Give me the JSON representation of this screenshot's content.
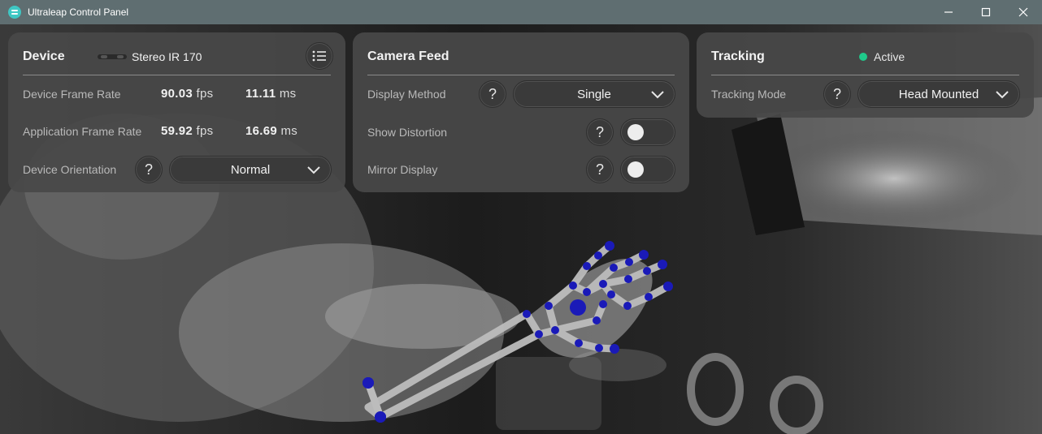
{
  "window": {
    "title": "Ultraleap Control Panel"
  },
  "device_panel": {
    "title": "Device",
    "device_name": "Stereo IR 170",
    "rows": [
      {
        "label": "Device Frame Rate",
        "fps_value": "90.03",
        "fps_unit": "fps",
        "ms_value": "11.11",
        "ms_unit": "ms"
      },
      {
        "label": "Application Frame Rate",
        "fps_value": "59.92",
        "fps_unit": "fps",
        "ms_value": "16.69",
        "ms_unit": "ms"
      }
    ],
    "orientation": {
      "label": "Device Orientation",
      "help": "?",
      "value": "Normal"
    }
  },
  "camera_panel": {
    "title": "Camera Feed",
    "display_method": {
      "label": "Display Method",
      "help": "?",
      "value": "Single"
    },
    "show_distortion": {
      "label": "Show Distortion",
      "help": "?",
      "on": false
    },
    "mirror_display": {
      "label": "Mirror Display",
      "help": "?",
      "on": false
    }
  },
  "tracking_panel": {
    "title": "Tracking",
    "status": "Active",
    "status_color": "#1fc98a",
    "mode": {
      "label": "Tracking Mode",
      "help": "?",
      "value": "Head Mounted"
    }
  },
  "colors": {
    "titlebar": "#5f6e71",
    "joint": "#1a1ab8",
    "bone": "#bcbcbc"
  }
}
